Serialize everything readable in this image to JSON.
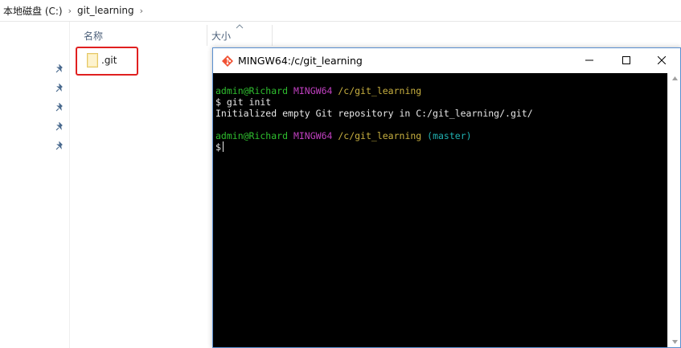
{
  "explorer": {
    "breadcrumb": [
      "本地磁盘 (C:)",
      "git_learning"
    ],
    "columns": {
      "name": "名称",
      "size": "大小"
    },
    "files": [
      {
        "name": ".git",
        "icon": "folder-icon"
      }
    ],
    "highlight_color": "#e02020"
  },
  "terminal": {
    "title": "MINGW64:/c/git_learning",
    "prompt1": {
      "user": "admin@Richard",
      "env": "MINGW64",
      "path": "/c/git_learning"
    },
    "command": "$ git init",
    "output": "Initialized empty Git repository in C:/git_learning/.git/",
    "prompt2": {
      "user": "admin@Richard",
      "env": "MINGW64",
      "path": "/c/git_learning",
      "branch": "(master)"
    },
    "input_prompt": "$",
    "colors": {
      "user": "#2fbf2f",
      "env": "#c040c0",
      "path": "#c8b040",
      "branch": "#20b0b0"
    }
  }
}
